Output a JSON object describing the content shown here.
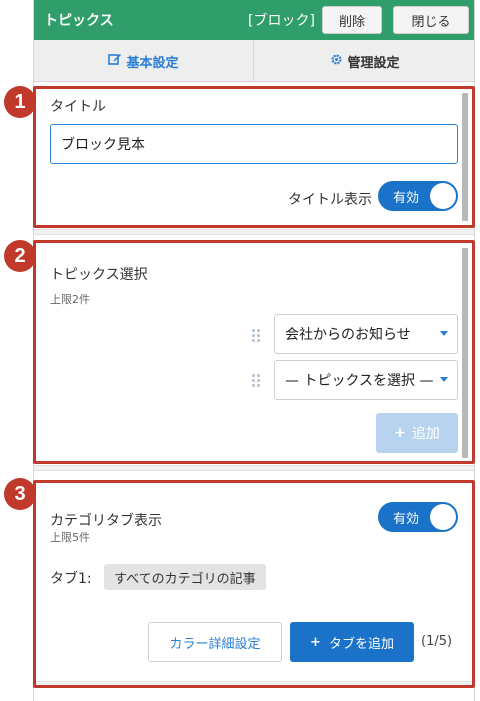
{
  "header": {
    "title": "トピックス",
    "block_type": "[ブロック]",
    "delete_label": "削除",
    "close_label": "閉じる"
  },
  "tabs": {
    "basic": "基本設定",
    "manage": "管理設定"
  },
  "section1": {
    "badge": "1",
    "title_label": "タイトル",
    "title_value": "ブロック見本",
    "show_title_label": "タイトル表示",
    "toggle_label": "有効"
  },
  "section2": {
    "badge": "2",
    "title": "トピックス選択",
    "limit": "上限2件",
    "selects": [
      "会社からのお知らせ",
      "— トピックスを選択 —"
    ],
    "add_label": "追加"
  },
  "section3": {
    "badge": "3",
    "title": "カテゴリタブ表示",
    "limit": "上限5件",
    "toggle_label": "有効",
    "tab1_label": "タブ1:",
    "tab1_value": "すべてのカテゴリの記事",
    "color_button": "カラー詳細設定",
    "add_tab_button": "タブを追加",
    "count": "(1/5)"
  },
  "colors": {
    "header_green": "#2f9e6a",
    "primary_blue": "#1a73c9",
    "annotation_red": "#c0392b"
  }
}
